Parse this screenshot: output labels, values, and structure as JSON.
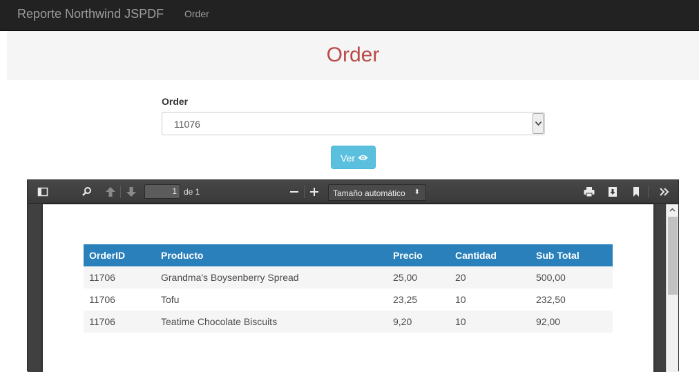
{
  "navbar": {
    "brand": "Reporte Northwind JSPDF",
    "link": "Order"
  },
  "header": {
    "title": "Order"
  },
  "form": {
    "label": "Order",
    "selected_value": "11076",
    "button_label": "Ver"
  },
  "viewer": {
    "page_number": "1",
    "page_of": "de 1",
    "zoom_label": "Tamaño automático",
    "table": {
      "headers": [
        "OrderID",
        "Producto",
        "Precio",
        "Cantidad",
        "Sub Total"
      ],
      "rows": [
        [
          "11706",
          "Grandma's Boysenberry Spread",
          "25,00",
          "20",
          "500,00"
        ],
        [
          "11706",
          "Tofu",
          "23,25",
          "10",
          "232,50"
        ],
        [
          "11706",
          "Teatime Chocolate Biscuits",
          "9,20",
          "10",
          "92,00"
        ]
      ]
    }
  },
  "colors": {
    "header_blue": "#2980ba",
    "title_red": "#b94a48",
    "button_info": "#5bc0de"
  }
}
